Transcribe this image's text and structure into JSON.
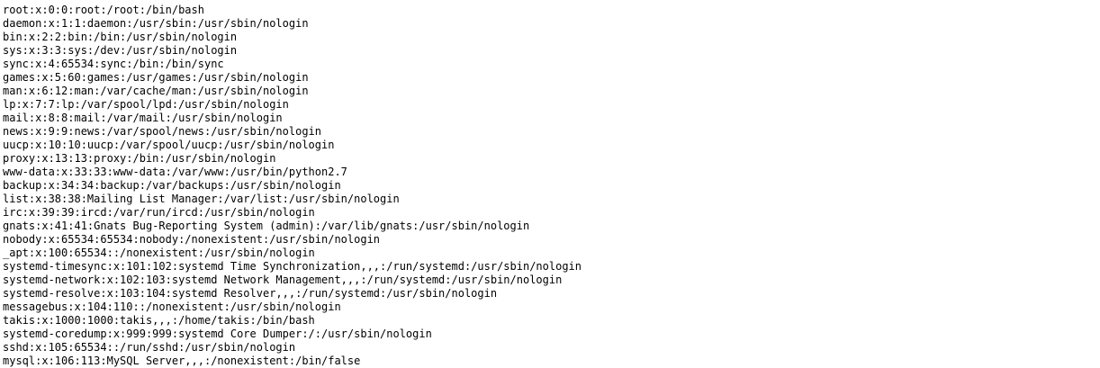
{
  "document": {
    "lines": [
      "root:x:0:0:root:/root:/bin/bash",
      "daemon:x:1:1:daemon:/usr/sbin:/usr/sbin/nologin",
      "bin:x:2:2:bin:/bin:/usr/sbin/nologin",
      "sys:x:3:3:sys:/dev:/usr/sbin/nologin",
      "sync:x:4:65534:sync:/bin:/bin/sync",
      "games:x:5:60:games:/usr/games:/usr/sbin/nologin",
      "man:x:6:12:man:/var/cache/man:/usr/sbin/nologin",
      "lp:x:7:7:lp:/var/spool/lpd:/usr/sbin/nologin",
      "mail:x:8:8:mail:/var/mail:/usr/sbin/nologin",
      "news:x:9:9:news:/var/spool/news:/usr/sbin/nologin",
      "uucp:x:10:10:uucp:/var/spool/uucp:/usr/sbin/nologin",
      "proxy:x:13:13:proxy:/bin:/usr/sbin/nologin",
      "www-data:x:33:33:www-data:/var/www:/usr/bin/python2.7",
      "backup:x:34:34:backup:/var/backups:/usr/sbin/nologin",
      "list:x:38:38:Mailing List Manager:/var/list:/usr/sbin/nologin",
      "irc:x:39:39:ircd:/var/run/ircd:/usr/sbin/nologin",
      "gnats:x:41:41:Gnats Bug-Reporting System (admin):/var/lib/gnats:/usr/sbin/nologin",
      "nobody:x:65534:65534:nobody:/nonexistent:/usr/sbin/nologin",
      "_apt:x:100:65534::/nonexistent:/usr/sbin/nologin",
      "systemd-timesync:x:101:102:systemd Time Synchronization,,,:/run/systemd:/usr/sbin/nologin",
      "systemd-network:x:102:103:systemd Network Management,,,:/run/systemd:/usr/sbin/nologin",
      "systemd-resolve:x:103:104:systemd Resolver,,,:/run/systemd:/usr/sbin/nologin",
      "messagebus:x:104:110::/nonexistent:/usr/sbin/nologin",
      "takis:x:1000:1000:takis,,,:/home/takis:/bin/bash",
      "systemd-coredump:x:999:999:systemd Core Dumper:/:/usr/sbin/nologin",
      "sshd:x:105:65534::/run/sshd:/usr/sbin/nologin",
      "mysql:x:106:113:MySQL Server,,,:/nonexistent:/bin/false"
    ]
  }
}
